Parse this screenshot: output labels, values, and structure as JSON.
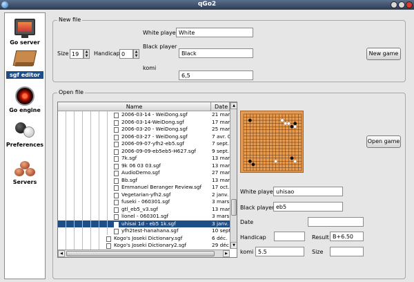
{
  "window": {
    "title": "qGo2"
  },
  "sidebar": {
    "items": [
      {
        "label": "Go server",
        "icon": "monitor-icon",
        "selected": false
      },
      {
        "label": "sgf editor",
        "icon": "go-board-icon",
        "selected": true
      },
      {
        "label": "Go engine",
        "icon": "hal-eye-icon",
        "selected": false
      },
      {
        "label": "Preferences",
        "icon": "go-stones-icon",
        "selected": false
      },
      {
        "label": "Servers",
        "icon": "servers-icon",
        "selected": false
      }
    ]
  },
  "new_file": {
    "group_title": "New file",
    "size_label": "Size",
    "size_value": "19",
    "handicap_label": "Handicap",
    "handicap_value": "0",
    "white_label": "White player",
    "white_value": "White",
    "black_label": "Black player",
    "black_value": "Black",
    "komi_label": "komi",
    "komi_value": "6,5",
    "new_game_button": "New game"
  },
  "open_file": {
    "group_title": "Open file",
    "columns": {
      "name": "Name",
      "date": "Date m"
    },
    "rows": [
      {
        "name": "2006-03-14 - WeiDong.sgf",
        "date": "21 mar",
        "depth": 7,
        "selected": false
      },
      {
        "name": "2006-03-14-WeiDong.sgf",
        "date": "17 mar",
        "depth": 7,
        "selected": false
      },
      {
        "name": "2006-03-20 - WeiDong.sgf",
        "date": "25 mar",
        "depth": 7,
        "selected": false
      },
      {
        "name": "2006-03-27 - WeiDong.sgf",
        "date": "7 avr. 0",
        "depth": 7,
        "selected": false
      },
      {
        "name": "2006-09-07-yfh2-eb5.sgf",
        "date": "7 sept.",
        "depth": 7,
        "selected": false
      },
      {
        "name": "2006-09-09-eb5eb5-H627.sgf",
        "date": "9 sept.",
        "depth": 7,
        "selected": false
      },
      {
        "name": "7k.sgf",
        "date": "13 mar",
        "depth": 7,
        "selected": false
      },
      {
        "name": "9k 06 03 03.sgf",
        "date": "13 mar",
        "depth": 7,
        "selected": false
      },
      {
        "name": "AudioDemo.sgf",
        "date": "27 mar",
        "depth": 7,
        "selected": false
      },
      {
        "name": "Bb.sgf",
        "date": "13 mar",
        "depth": 7,
        "selected": false
      },
      {
        "name": "Emmanuel Beranger Review.sgf",
        "date": "17 oct.",
        "depth": 7,
        "selected": false
      },
      {
        "name": "Vegetarian-yfh2.sgf",
        "date": "2 janv.",
        "depth": 7,
        "selected": false
      },
      {
        "name": "fuseki - 060301.sgf",
        "date": "3 mars",
        "depth": 7,
        "selected": false
      },
      {
        "name": "gtl_eb5_v3.sgf",
        "date": "13 mar",
        "depth": 7,
        "selected": false
      },
      {
        "name": "lionel - 060301.sgf",
        "date": "3 mars",
        "depth": 7,
        "selected": false
      },
      {
        "name": "uhisai 1d - eb5 1k.sgf",
        "date": "3 janv.",
        "depth": 7,
        "selected": true
      },
      {
        "name": "yfh2test-hanahana.sgf",
        "date": "10 sept",
        "depth": 7,
        "selected": false
      },
      {
        "name": "Kogo's Joseki Dictionary.sgf",
        "date": "6 déc.",
        "depth": 6,
        "selected": false
      },
      {
        "name": "Kogo's Joseki Dictionary2.sgf",
        "date": "29 déc",
        "depth": 6,
        "selected": false
      }
    ],
    "open_game_button": "Open game",
    "info": {
      "white_label": "White player",
      "white_value": "uhisao",
      "black_label": "Black player",
      "black_value": "eb5",
      "date_label": "Date",
      "date_value": "",
      "handicap_label": "Handicap",
      "handicap_value": "",
      "result_label": "Result",
      "result_value": "B+6.50",
      "komi_label": "komi",
      "komi_value": "5.5",
      "size_label": "Size",
      "size_value": ""
    },
    "preview": {
      "size": 19,
      "black_stones": [
        [
          2,
          2
        ],
        [
          16,
          3
        ],
        [
          15,
          4
        ],
        [
          2,
          15
        ],
        [
          15,
          14
        ],
        [
          3,
          16
        ]
      ],
      "white_stones": [
        [
          12,
          2
        ],
        [
          13,
          3
        ],
        [
          14,
          3
        ],
        [
          16,
          4
        ],
        [
          10,
          15
        ],
        [
          16,
          15
        ]
      ]
    }
  }
}
